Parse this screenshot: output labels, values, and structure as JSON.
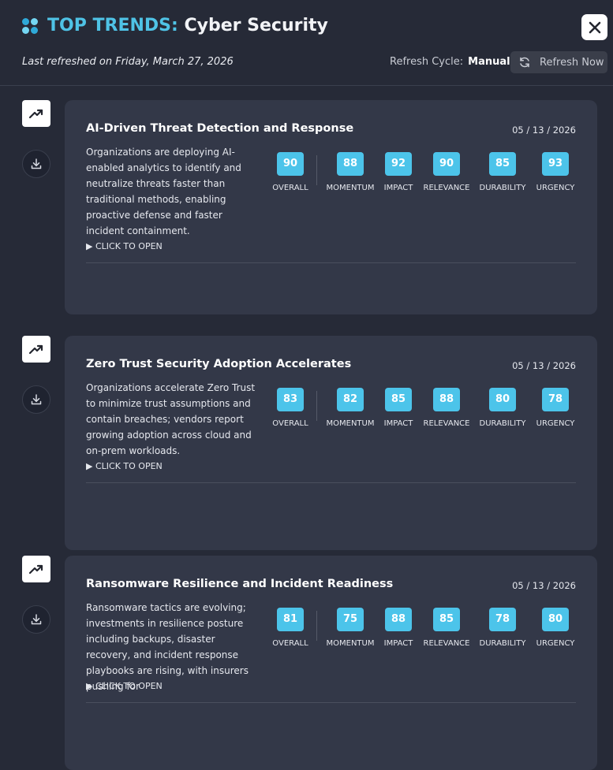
{
  "header": {
    "title_accent": "TOP TRENDS:",
    "title_subject": "Cyber Security",
    "last_refreshed": "Last refreshed on Friday, March 27, 2026",
    "refresh_cycle_label": "Refresh Cycle:",
    "refresh_cycle_value": "Manual",
    "refresh_button_label": "Refresh Now",
    "close_icon": "close-icon",
    "brand_color": "#4fc3e6"
  },
  "metric_labels": [
    "OVERALL",
    "MOMENTUM",
    "IMPACT",
    "RELEVANCE",
    "DURABILITY",
    "URGENCY"
  ],
  "cards": [
    {
      "title": "AI-Driven Threat Detection and Response",
      "date": "05 / 13 / 2026",
      "description": "Organizations are deploying AI-enabled analytics to identify and neutralize threats faster than traditional methods, enabling proactive defense and faster incident containment.",
      "open_label": "CLICK TO OPEN",
      "scores": [
        "90",
        "88",
        "92",
        "90",
        "85",
        "93"
      ]
    },
    {
      "title": "Zero Trust Security Adoption Accelerates",
      "date": "05 / 13 / 2026",
      "description": "Organizations accelerate Zero Trust to minimize trust assumptions and contain breaches; vendors report growing adoption across cloud and on-prem workloads.",
      "open_label": "CLICK TO OPEN",
      "scores": [
        "83",
        "82",
        "85",
        "88",
        "80",
        "78"
      ]
    },
    {
      "title": "Ransomware Resilience and Incident Readiness",
      "date": "05 / 13 / 2026",
      "description": "Ransomware tactics are evolving; investments in resilience posture including backups, disaster recovery, and incident response playbooks are rising, with insurers pushing for",
      "open_label": "CLICK TO OPEN",
      "scores": [
        "81",
        "75",
        "88",
        "85",
        "78",
        "80"
      ]
    }
  ],
  "icons": {
    "trend": "trending-up-icon",
    "download": "download-icon",
    "refresh": "refresh-icon",
    "logo": "logo-icon"
  }
}
